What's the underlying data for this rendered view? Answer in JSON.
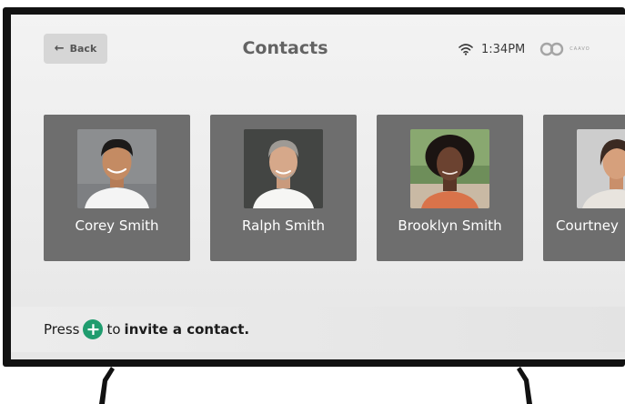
{
  "header": {
    "back_label": "Back",
    "title": "Contacts",
    "time": "1:34PM",
    "brand": "CAAVO"
  },
  "contacts": [
    {
      "name": "Corey Smith"
    },
    {
      "name": "Ralph Smith"
    },
    {
      "name": "Brooklyn Smith"
    },
    {
      "name": "Courtney"
    }
  ],
  "invite": {
    "prefix": "Press",
    "middle": "to",
    "action": "invite a contact.",
    "plus_color": "#1f9c6e"
  },
  "icons": [
    "back-arrow-icon",
    "wifi-icon",
    "caavo-logo",
    "plus-icon"
  ]
}
